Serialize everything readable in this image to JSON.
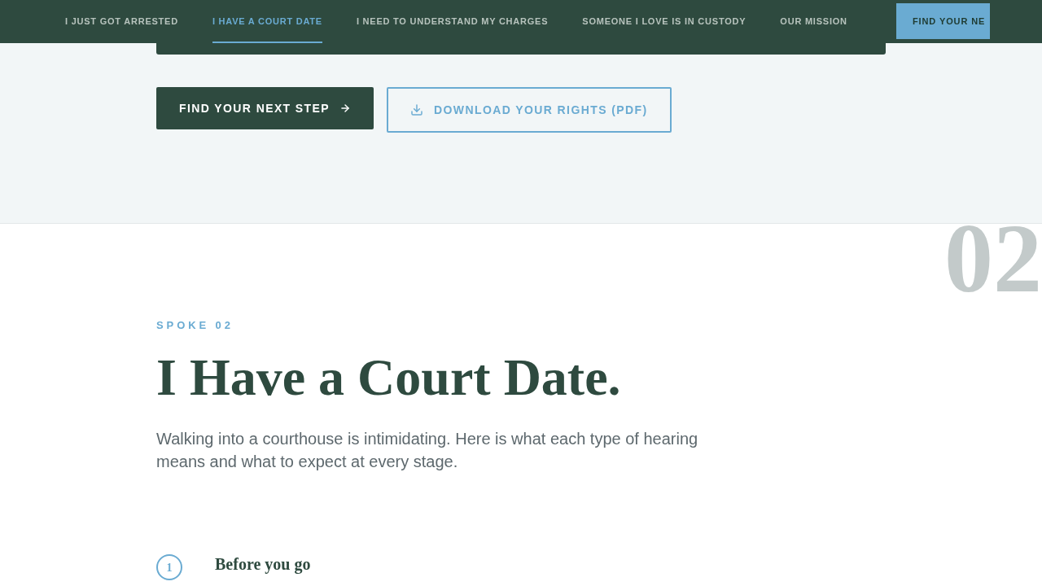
{
  "nav": {
    "items": [
      {
        "label": "I JUST GOT ARRESTED",
        "selected": false
      },
      {
        "label": "I HAVE A COURT DATE",
        "selected": true
      },
      {
        "label": "I NEED TO UNDERSTAND MY CHARGES",
        "selected": false
      },
      {
        "label": "SOMEONE I LOVE IS IN CUSTODY",
        "selected": false
      },
      {
        "label": "OUR MISSION",
        "selected": false
      }
    ],
    "cta": "FIND YOUR NE"
  },
  "hero_actions": {
    "primary": "FIND YOUR NEXT STEP",
    "secondary": "DOWNLOAD YOUR RIGHTS (PDF)"
  },
  "section": {
    "number": "02",
    "eyebrow": "SPOKE 02",
    "title": "I Have a Court Date.",
    "intro": "Walking into a courthouse is intimidating. Here is what each type of hearing means and what to expect at every stage.",
    "steps": [
      {
        "number": "1",
        "title": "Before you go"
      }
    ]
  }
}
